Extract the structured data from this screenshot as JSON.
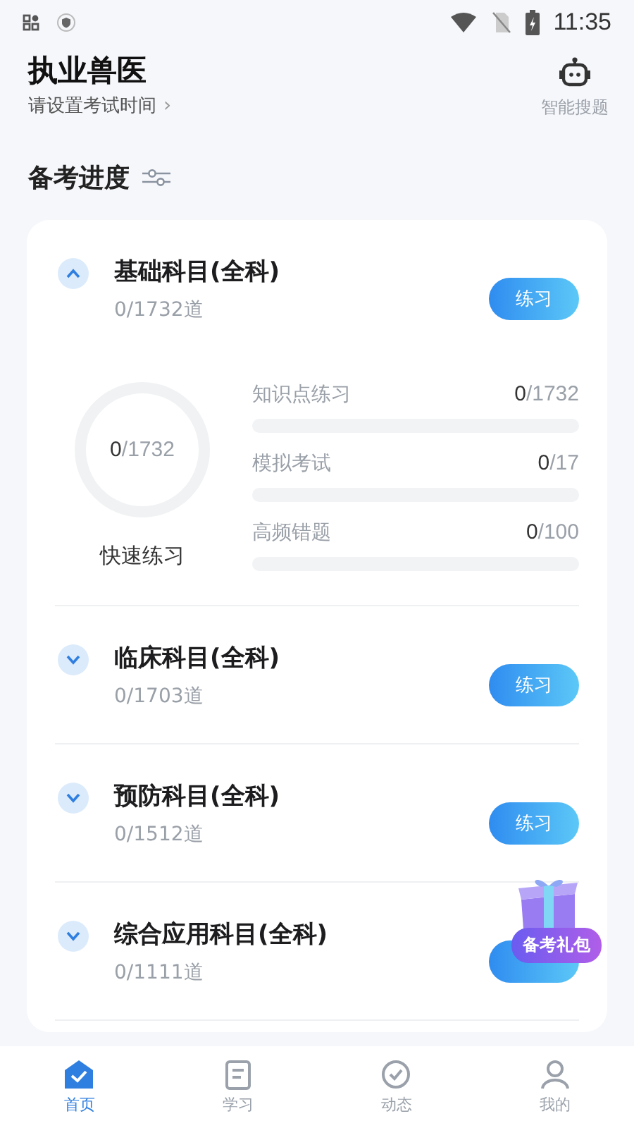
{
  "status_bar": {
    "time": "11:35"
  },
  "header": {
    "title": "执业兽医",
    "subtitle": "请设置考试时间",
    "chevron": "›",
    "assistant": {
      "label": "智能搜题"
    }
  },
  "section": {
    "title": "备考进度"
  },
  "subjects": [
    {
      "title": "基础科目(全科)",
      "count": "0/1732道",
      "expanded": true,
      "action": "练习",
      "detail": {
        "ring": {
          "done": "0",
          "total": "/1732",
          "caption": "快速练习"
        },
        "rows": [
          {
            "label": "知识点练习",
            "done": "0",
            "total": "/1732"
          },
          {
            "label": "模拟考试",
            "done": "0",
            "total": "/17"
          },
          {
            "label": "高频错题",
            "done": "0",
            "total": "/100"
          }
        ]
      }
    },
    {
      "title": "临床科目(全科)",
      "count": "0/1703道",
      "expanded": false,
      "action": "练习"
    },
    {
      "title": "预防科目(全科)",
      "count": "0/1512道",
      "expanded": false,
      "action": "练习"
    },
    {
      "title": "综合应用科目(全科)",
      "count": "0/1111道",
      "expanded": false
    }
  ],
  "promo": {
    "label": "备考礼包"
  },
  "tabs": [
    {
      "label": "首页",
      "selected": true
    },
    {
      "label": "学习",
      "selected": false
    },
    {
      "label": "动态",
      "selected": false
    },
    {
      "label": "我的",
      "selected": false
    }
  ]
}
